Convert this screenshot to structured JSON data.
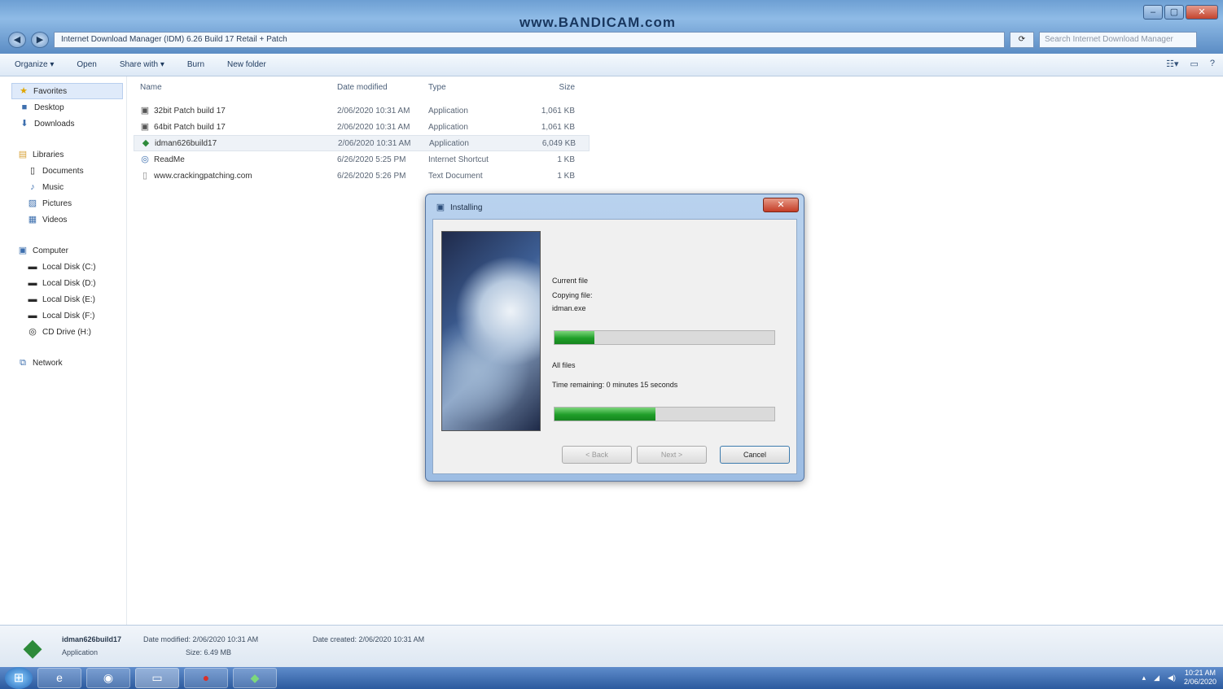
{
  "window": {
    "watermark": "www.BANDICAM.com",
    "address": "Internet Download Manager (IDM) 6.26 Build 17 Retail + Patch",
    "search_placeholder": "Search Internet Download Manager",
    "controls": {
      "minimize": "–",
      "maximize": "▢",
      "close": "✕"
    }
  },
  "toolbar": {
    "items": [
      "Organize ▾",
      "Open",
      "Share with ▾",
      "Burn",
      "New folder"
    ]
  },
  "sidebar": {
    "favorites": {
      "label": "Favorites",
      "items": [
        "Desktop",
        "Downloads"
      ]
    },
    "libraries": {
      "label": "Libraries",
      "items": [
        "Documents",
        "Music",
        "Pictures",
        "Videos"
      ]
    },
    "computer": {
      "label": "Computer",
      "items": [
        "Local Disk (C:)",
        "Local Disk (D:)",
        "Local Disk (E:)",
        "Local Disk (F:)",
        "CD Drive (H:)"
      ]
    },
    "network": {
      "label": "Network"
    }
  },
  "filelist": {
    "headers": {
      "name": "Name",
      "date": "Date modified",
      "type": "Type",
      "size": "Size"
    },
    "rows": [
      {
        "name": "32bit Patch build 17",
        "date": "2/06/2020 10:31 AM",
        "type": "Application",
        "size": "1,061 KB"
      },
      {
        "name": "64bit Patch build 17",
        "date": "2/06/2020 10:31 AM",
        "type": "Application",
        "size": "1,061 KB"
      },
      {
        "name": "idman626build17",
        "date": "2/06/2020 10:31 AM",
        "type": "Application",
        "size": "6,049 KB"
      },
      {
        "name": "ReadMe",
        "date": "6/26/2020 5:25 PM",
        "type": "Internet Shortcut",
        "size": "1 KB"
      },
      {
        "name": "www.crackingpatching.com",
        "date": "6/26/2020 5:26 PM",
        "type": "Text Document",
        "size": "1 KB"
      }
    ]
  },
  "dialog": {
    "title": "Installing",
    "close": "✕",
    "current_file_label": "Current file",
    "copying_label": "Copying file:",
    "copying_file": "idman.exe",
    "files_label": "All files",
    "time_remaining": "Time remaining: 0 minutes 15 seconds",
    "file_progress": 0.18,
    "total_progress": 0.46,
    "buttons": {
      "back": "< Back",
      "next": "Next >",
      "cancel": "Cancel"
    }
  },
  "details": {
    "name": "idman626build17",
    "type": "Application",
    "date_modified": "Date modified: 2/06/2020 10:31 AM",
    "size": "Size: 6.49 MB",
    "date_created": "Date created: 2/06/2020 10:31 AM"
  },
  "taskbar": {
    "clock_time": "10:21 AM",
    "clock_date": "2/06/2020"
  }
}
